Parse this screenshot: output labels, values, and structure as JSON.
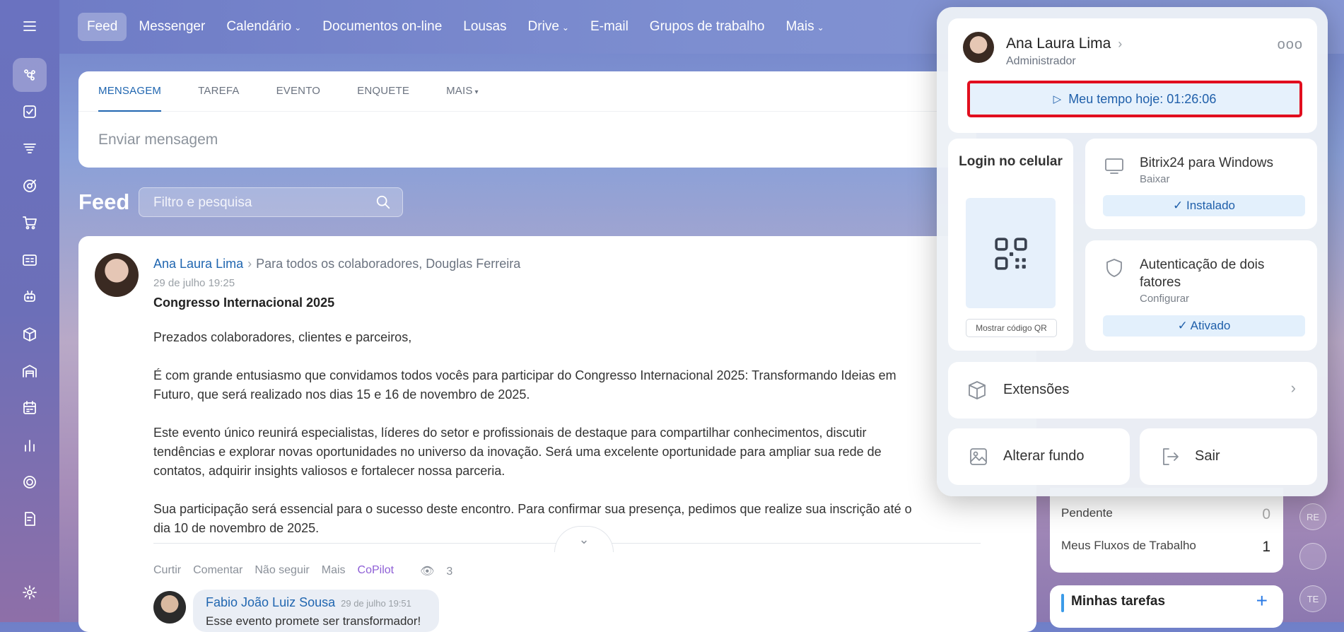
{
  "nav": {
    "items": [
      {
        "label": "Feed",
        "active": true,
        "dropdown": false
      },
      {
        "label": "Messenger",
        "dropdown": false
      },
      {
        "label": "Calendário",
        "dropdown": true
      },
      {
        "label": "Documentos on-line",
        "dropdown": false
      },
      {
        "label": "Lousas",
        "dropdown": false
      },
      {
        "label": "Drive",
        "dropdown": true
      },
      {
        "label": "E-mail",
        "dropdown": false
      },
      {
        "label": "Grupos de trabalho",
        "dropdown": false
      },
      {
        "label": "Mais",
        "dropdown": true
      }
    ]
  },
  "composer": {
    "tabs": [
      "MENSAGEM",
      "TAREFA",
      "EVENTO",
      "ENQUETE",
      "MAIS"
    ],
    "placeholder": "Enviar mensagem"
  },
  "feed": {
    "title": "Feed",
    "search_placeholder": "Filtro e pesquisa"
  },
  "post": {
    "author": "Ana Laura Lima",
    "recipients": "Para todos os colaboradores, Douglas Ferreira",
    "date": "29 de julho 19:25",
    "title": "Congresso Internacional 2025",
    "paragraphs": [
      "Prezados colaboradores, clientes e parceiros,",
      "É com grande entusiasmo que convidamos todos vocês para participar do Congresso Internacional 2025: Transformando Ideias em Futuro, que será realizado nos dias 15 e 16 de novembro de 2025.",
      "Este evento único reunirá especialistas, líderes do setor e profissionais de destaque para compartilhar conhecimentos, discutir tendências e explorar novas oportunidades no universo da inovação. Será uma excelente oportunidade para ampliar sua rede de contatos, adquirir insights valiosos e fortalecer nossa parceria.",
      "Sua participação será essencial para o sucesso deste encontro. Para confirmar sua presença, pedimos que realize sua inscrição até o dia 10 de novembro de 2025."
    ],
    "actions": {
      "like": "Curtir",
      "comment": "Comentar",
      "unfollow": "Não seguir",
      "more": "Mais",
      "copilot": "CoPilot",
      "views": "3"
    },
    "comment": {
      "author": "Fabio João Luiz Sousa",
      "date": "29 de julho 19:51",
      "text": "Esse evento promete ser transformador!"
    }
  },
  "widgets": {
    "pending_label": "Pendente",
    "pending_count": "0",
    "flows_label": "Meus Fluxos de Trabalho",
    "flows_count": "1",
    "tasks_title": "Minhas tarefas",
    "add": "+",
    "mini_avatars": [
      "RE",
      "TE"
    ]
  },
  "profile_popup": {
    "user_name": "Ana Laura Lima",
    "role": "Administrador",
    "more": "ooo",
    "time_today": "Meu tempo hoje: 01:26:06",
    "login_mobile_title": "Login no celular",
    "show_qr": "Mostrar código QR",
    "desktop_app": {
      "title": "Bitrix24 para Windows",
      "subtitle": "Baixar",
      "status": "Instalado"
    },
    "two_factor": {
      "title": "Autenticação de dois fatores",
      "subtitle": "Configurar",
      "status": "Ativado"
    },
    "extensions": "Extensões",
    "change_background": "Alterar fundo",
    "logout": "Sair"
  },
  "colors": {
    "accent": "#2066b0",
    "highlight_border": "#e10e1e",
    "copilot": "#8e5fd6"
  }
}
